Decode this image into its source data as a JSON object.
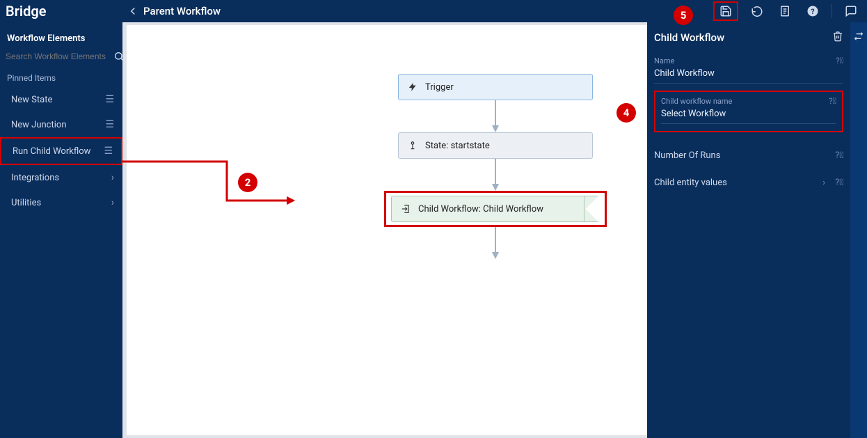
{
  "app": {
    "brand": "Bridge"
  },
  "header": {
    "title": "Parent Workflow"
  },
  "sidebar": {
    "heading": "Workflow Elements",
    "search_placeholder": "Search Workflow Elements",
    "pinned_heading": "Pinned Items",
    "items": [
      {
        "label": "New State",
        "kind": "drag"
      },
      {
        "label": "New Junction",
        "kind": "drag"
      },
      {
        "label": "Run Child Workflow",
        "kind": "drag",
        "highlight": true
      },
      {
        "label": "Integrations",
        "kind": "expand"
      },
      {
        "label": "Utilities",
        "kind": "expand"
      }
    ]
  },
  "canvas": {
    "nodes": {
      "trigger_label": "Trigger",
      "state_label": "State: startstate",
      "child_label": "Child Workflow: Child Workflow"
    }
  },
  "right_panel": {
    "title": "Child Workflow",
    "name_label": "Name",
    "name_value": "Child Workflow",
    "child_name_label": "Child workflow name",
    "child_name_value": "Select Workflow",
    "runs_label": "Number Of Runs",
    "entity_label": "Child entity values"
  },
  "callouts": {
    "two": "2",
    "four": "4",
    "five": "5"
  }
}
